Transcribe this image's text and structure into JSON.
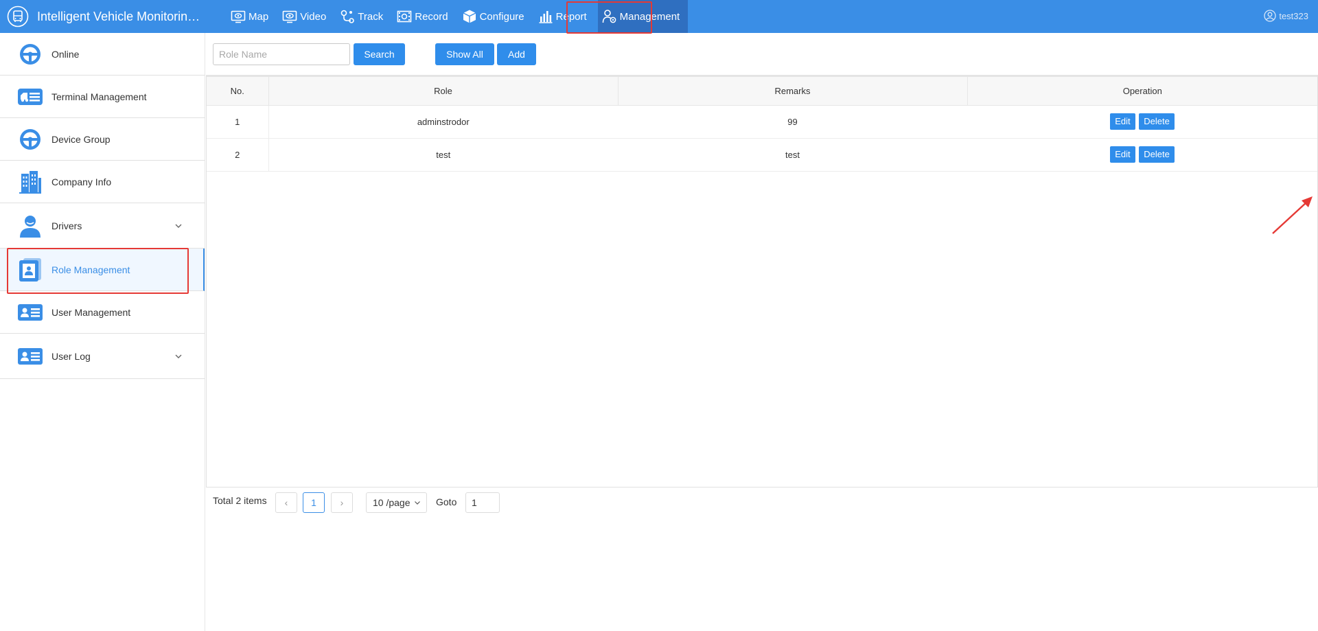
{
  "app": {
    "title": "Intelligent Vehicle Monitoring System",
    "user": "test323"
  },
  "nav": {
    "items": [
      {
        "label": "Map",
        "icon": "map-monitor-icon"
      },
      {
        "label": "Video",
        "icon": "video-eye-icon"
      },
      {
        "label": "Track",
        "icon": "track-pin-icon"
      },
      {
        "label": "Record",
        "icon": "record-film-icon"
      },
      {
        "label": "Configure",
        "icon": "configure-box-icon"
      },
      {
        "label": "Report",
        "icon": "report-bars-icon"
      },
      {
        "label": "Management",
        "icon": "management-user-icon",
        "active": true
      }
    ]
  },
  "sidebar": {
    "items": [
      {
        "label": "Online",
        "icon": "steering-wheel-icon"
      },
      {
        "label": "Terminal Management",
        "icon": "terminal-truck-icon"
      },
      {
        "label": "Device Group",
        "icon": "steering-wheel-icon"
      },
      {
        "label": "Company Info",
        "icon": "building-icon"
      },
      {
        "label": "Drivers",
        "icon": "driver-icon",
        "expandable": true
      },
      {
        "label": "Role Management",
        "icon": "role-card-icon",
        "active": true
      },
      {
        "label": "User Management",
        "icon": "id-card-icon"
      },
      {
        "label": "User Log",
        "icon": "id-card-icon",
        "expandable": true
      }
    ]
  },
  "toolbar": {
    "role_placeholder": "Role Name",
    "search_label": "Search",
    "show_all_label": "Show All",
    "add_label": "Add"
  },
  "table": {
    "headers": [
      "No.",
      "Role",
      "Remarks",
      "Operation"
    ],
    "rows": [
      {
        "no": "1",
        "role": "adminstrodor",
        "remarks": "99"
      },
      {
        "no": "2",
        "role": "test",
        "remarks": "test"
      }
    ],
    "edit_label": "Edit",
    "delete_label": "Delete"
  },
  "pager": {
    "total": "Total 2 items",
    "prev": "‹",
    "next": "›",
    "current_page": "1",
    "page_size": "10 /page",
    "goto_label": "Goto",
    "goto_value": "1"
  },
  "colors": {
    "primary": "#3a8ee6",
    "button": "#2f8deb",
    "highlight": "#e53935"
  }
}
